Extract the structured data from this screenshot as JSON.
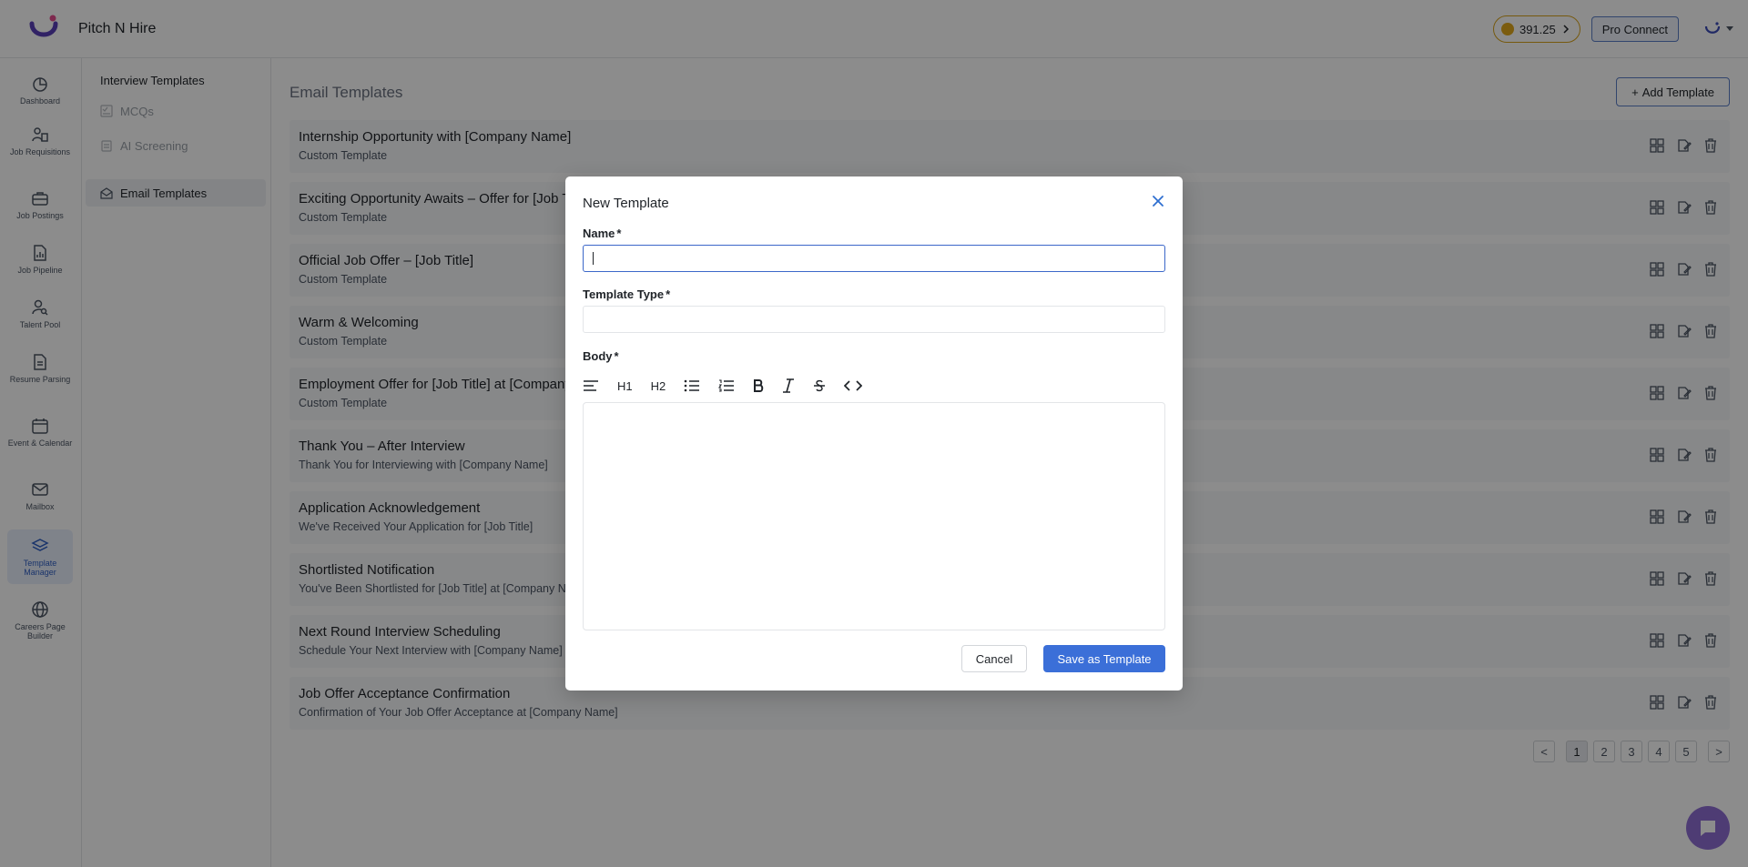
{
  "app": {
    "title": "Pitch N Hire",
    "credits": "391.25",
    "pro_connect_label": "Pro Connect"
  },
  "rail": {
    "items": [
      {
        "label": "Dashboard"
      },
      {
        "label": "Job Requisitions"
      },
      {
        "label": "Job Postings"
      },
      {
        "label": "Job Pipeline"
      },
      {
        "label": "Talent Pool"
      },
      {
        "label": "Resume Parsing"
      },
      {
        "label": "Event & Calendar"
      },
      {
        "label": "Mailbox"
      },
      {
        "label": "Template Manager"
      },
      {
        "label": "Careers Page Builder"
      }
    ]
  },
  "subnav": {
    "heading": "Interview Templates",
    "items": [
      {
        "label": "MCQs"
      },
      {
        "label": "AI Screening"
      },
      {
        "label": "Email Templates"
      }
    ]
  },
  "main": {
    "title": "Email Templates",
    "add_label": "Add Template",
    "templates": [
      {
        "title": "Internship Opportunity with [Company Name]",
        "sub": "Custom Template"
      },
      {
        "title": "Exciting Opportunity Awaits – Offer for [Job Title]",
        "sub": "Custom Template"
      },
      {
        "title": "Official Job Offer – [Job Title]",
        "sub": "Custom Template"
      },
      {
        "title": "Warm & Welcoming",
        "sub": "Custom Template"
      },
      {
        "title": "Employment Offer for [Job Title] at [Company Name]",
        "sub": "Custom Template"
      },
      {
        "title": "Thank You – After Interview",
        "sub": "Thank You for Interviewing with [Company Name]"
      },
      {
        "title": "Application Acknowledgement",
        "sub": "We've Received Your Application for [Job Title]"
      },
      {
        "title": "Shortlisted Notification",
        "sub": "You've Been Shortlisted for [Job Title] at [Company Name]"
      },
      {
        "title": "Next Round Interview Scheduling",
        "sub": "Schedule Your Next Interview with [Company Name]"
      },
      {
        "title": "Job Offer Acceptance Confirmation",
        "sub": "Confirmation of Your Job Offer Acceptance at [Company Name]"
      }
    ],
    "pager": {
      "prev": "<",
      "pages": [
        "1",
        "2",
        "3",
        "4",
        "5"
      ],
      "next": ">"
    }
  },
  "modal": {
    "title": "New Template",
    "name_label": "Name",
    "type_label": "Template Type",
    "body_label": "Body",
    "required_mark": "*",
    "name_value": "",
    "type_value": "",
    "toolbar": {
      "h1": "H1",
      "h2": "H2"
    },
    "cancel_label": "Cancel",
    "save_label": "Save as Template"
  }
}
